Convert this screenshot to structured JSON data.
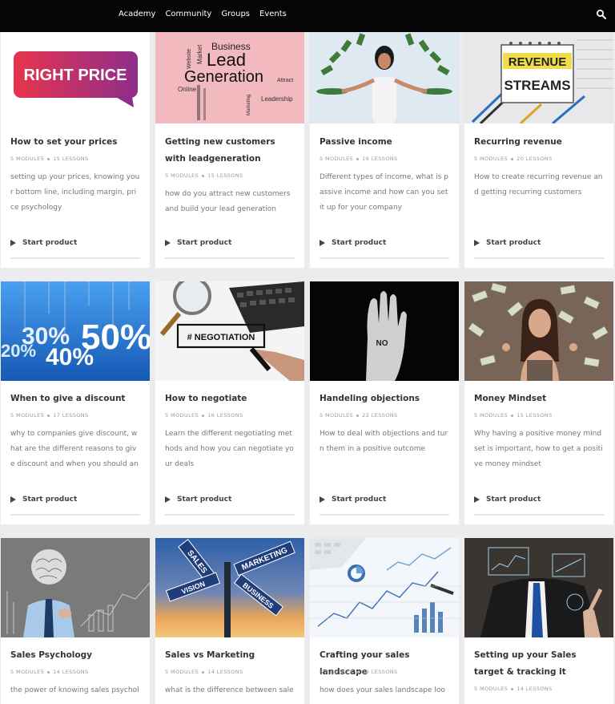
{
  "nav": {
    "items": [
      "Academy",
      "Community",
      "Groups",
      "Events"
    ],
    "search_icon": "search-icon"
  },
  "cards": [
    {
      "title": "How to set your prices",
      "modules": "5 MODULES",
      "lessons": "15 LESSONS",
      "desc": "setting up your prices, knowing your bottom line, including margin, price psychology",
      "start": "Start product",
      "thumb_text": "RIGHT PRICE"
    },
    {
      "title": "Getting new customers with leadgeneration",
      "modules": "5 MODULES",
      "lessons": "15 LESSONS",
      "desc": "how do you attract new customers and build your lead generation",
      "start": "Start product",
      "thumb_words": [
        "Business",
        "Lead",
        "Generation",
        "Market",
        "Website",
        "Online",
        "Leadership",
        "Attract",
        "Marketing"
      ]
    },
    {
      "title": "Passive income",
      "modules": "5 MODULES",
      "lessons": "16 LESSONS",
      "desc": "Different types of income, what is passive income and how can you set it up for your company",
      "start": "Start product"
    },
    {
      "title": "Recurring revenue",
      "modules": "5 MODULES",
      "lessons": "20 LESSONS",
      "desc": "How to create recurring revenue and getting recurring customers",
      "start": "Start product",
      "thumb_lines": [
        "REVENUE",
        "STREAMS"
      ]
    },
    {
      "title": "When to give a discount",
      "modules": "5 MODULES",
      "lessons": "17 LESSONS",
      "desc": "why to companies give discount, what are the different reasons to give discount and when you should and sh...",
      "start": "Start product",
      "thumb_numbers": [
        "50%",
        "30%",
        "20%",
        "40%"
      ]
    },
    {
      "title": "How to negotiate",
      "modules": "5 MODULES",
      "lessons": "16 LESSONS",
      "desc": "Learn the different negotiating methods and how you can negotiate your deals",
      "start": "Start product",
      "thumb_text": "# NEGOTIATION"
    },
    {
      "title": "Handeling objections",
      "modules": "5 MODULES",
      "lessons": "22 LESSONS",
      "desc": "How to deal with objections and turn them in a positive outcome",
      "start": "Start product",
      "thumb_text": "NO"
    },
    {
      "title": "Money Mindset",
      "modules": "5 MODULES",
      "lessons": "15 LESSONS",
      "desc": "Why having a positive money mindset is important, how to get a positive money mindset",
      "start": "Start product"
    },
    {
      "title": "Sales Psychology",
      "modules": "5 MODULES",
      "lessons": "14 LESSONS",
      "desc": "the power of knowing sales psycholo",
      "start": "Start product"
    },
    {
      "title": "Sales vs Marketing",
      "modules": "5 MODULES",
      "lessons": "14 LESSONS",
      "desc": "what is the difference between sales",
      "start": "Start product",
      "thumb_signs": [
        "SALES",
        "MARKETING",
        "VISION",
        "BUSINESS"
      ]
    },
    {
      "title": "Crafting your sales landscape",
      "modules": "5 MODULES",
      "lessons": "16 LESSONS",
      "desc": "how does your sales landscape look l",
      "start": "Start product"
    },
    {
      "title": "Setting up your Sales target & tracking it",
      "modules": "5 MODULES",
      "lessons": "14 LESSONS",
      "desc": "",
      "start": "Start product"
    }
  ]
}
